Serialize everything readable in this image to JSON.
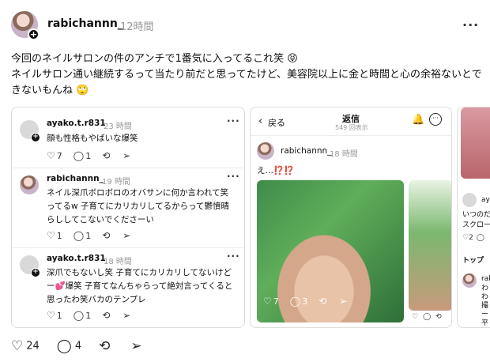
{
  "post": {
    "username": "rabichannn_",
    "time": "12時間",
    "text_line1": "今回のネイルサロンの件のアンチで1番気に入ってるこれ笑 😝",
    "text_line2": "ネイルサロン通い継続するって当たり前だと思ってたけど、美容院以上に金と時間と心の余裕ないとで",
    "text_line3": "きないもんね 🙄",
    "likes": "24",
    "comments": "4",
    "more_icon": "more-dots-icon"
  },
  "card1": {
    "c1_user": "ayako.t.r831",
    "c1_time": "23 時間",
    "c1_text": "顔も性格もやばいな爆笑",
    "c1_likes": "7",
    "c1_comments": "1",
    "c2_user": "rabichannn_",
    "c2_time": "19 時間",
    "c2_text1": "ネイル深爪ボロボロのオバサンに何か言われて笑",
    "c2_text2": "ってるw 子育てにカリカリしてるからって鬱憤晴",
    "c2_text3": "らししてこないでくださーい",
    "c2_likes": "1",
    "c2_comments": "1",
    "c3_user": "ayako.t.r831",
    "c3_time": "18 時間",
    "c3_text1": "深爪でもないし笑 子育てにカリカリしてないけど",
    "c3_text2": "ー💕爆笑 子育てなんちゃらって絶対言ってくると",
    "c3_text3": "思ったわ笑バカのテンプレ",
    "c3_likes": "1",
    "c3_comments": "1"
  },
  "card2": {
    "back": "戻る",
    "title": "返信",
    "views": "549 回表示",
    "user": "rabichannn_",
    "time": "18 時間",
    "text": "え…⁉️⁉️",
    "likes": "7",
    "comments": "3"
  },
  "card3": {
    "user_partial": "aya",
    "text1": "いつのだろ",
    "text2": "スクロール",
    "likes": "2",
    "tab": "トップ",
    "user2_partial": "rab",
    "t1": "わ",
    "t2": "わ",
    "t3": "撮",
    "t4": "ー",
    "t5": "平"
  }
}
